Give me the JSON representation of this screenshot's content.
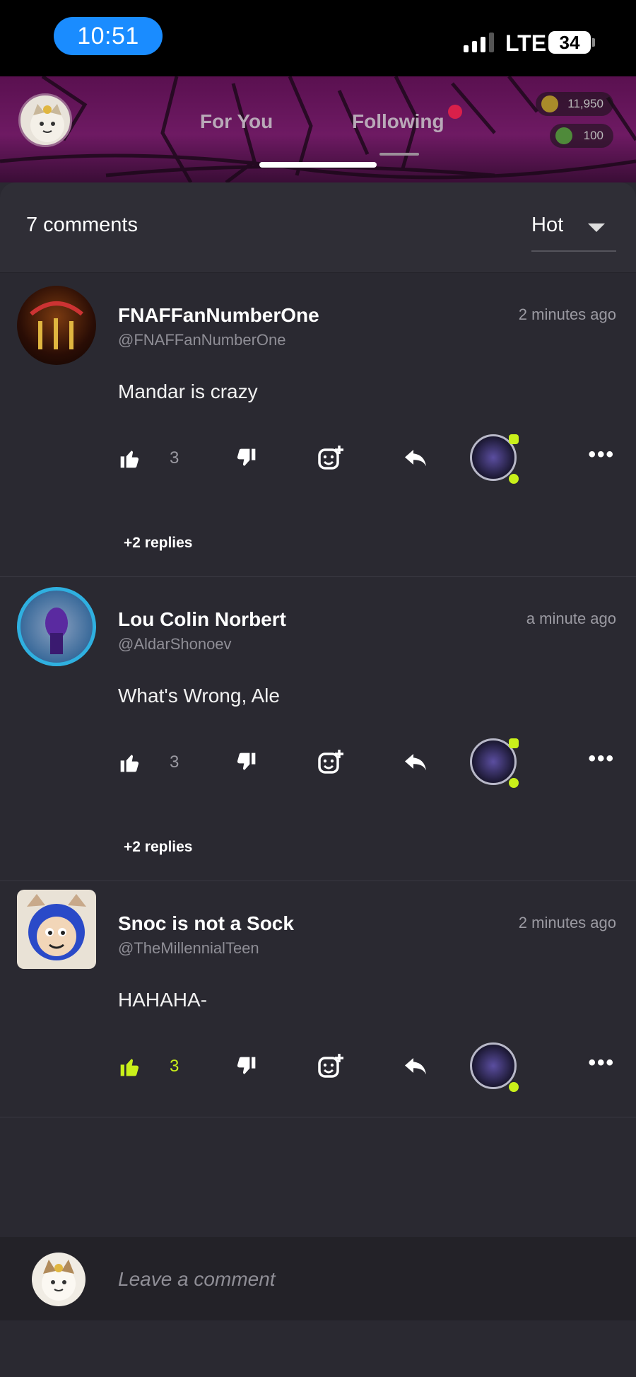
{
  "status_bar": {
    "time": "10:51",
    "network": "LTE",
    "battery": "34"
  },
  "header": {
    "tabs": [
      {
        "label": "For You"
      },
      {
        "label": "Following"
      }
    ],
    "coins": "11,950",
    "gems": "100"
  },
  "comments_panel": {
    "count_label": "7 comments",
    "sort_label": "Hot"
  },
  "comments": [
    {
      "name": "FNAFFanNumberOne",
      "handle": "@FNAFFanNumberOne",
      "time": "2 minutes ago",
      "text": "Mandar is crazy",
      "likes": "3",
      "replies": "+2 replies"
    },
    {
      "name": "Lou Colin Norbert",
      "handle": "@AldarShonoev",
      "time": "a minute ago",
      "text": "What's Wrong, Ale",
      "likes": "3",
      "replies": "+2 replies"
    },
    {
      "name": "Snoc is not a Sock",
      "handle": "@TheMillennialTeen",
      "time": "2 minutes ago",
      "text": "HAHAHA-",
      "likes": "3"
    }
  ],
  "composer": {
    "placeholder": "Leave a comment"
  },
  "colors": {
    "accent_like": "#c9f01a",
    "background": "#2a2931",
    "header_purple": "#6e1a63"
  },
  "icons": [
    "thumbs-up-icon",
    "thumbs-down-icon",
    "add-reaction-icon",
    "reply-icon",
    "more-icon"
  ]
}
